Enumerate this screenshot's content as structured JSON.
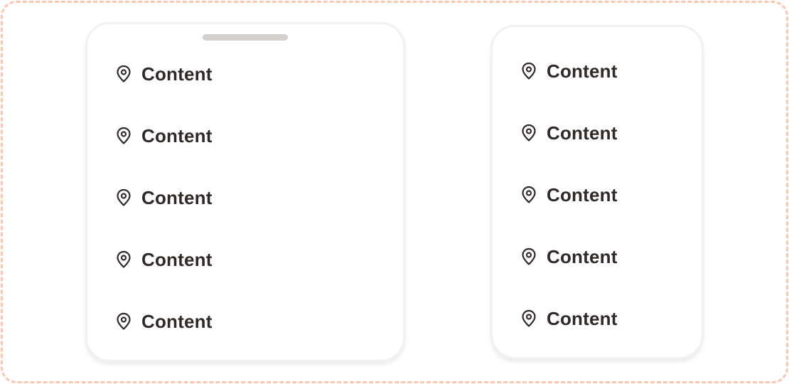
{
  "left_sheet": {
    "items": [
      {
        "label": "Content",
        "icon": "location-pin-icon"
      },
      {
        "label": "Content",
        "icon": "location-pin-icon"
      },
      {
        "label": "Content",
        "icon": "location-pin-icon"
      },
      {
        "label": "Content",
        "icon": "location-pin-icon"
      },
      {
        "label": "Content",
        "icon": "location-pin-icon"
      }
    ]
  },
  "right_sheet": {
    "items": [
      {
        "label": "Content",
        "icon": "location-pin-icon"
      },
      {
        "label": "Content",
        "icon": "location-pin-icon"
      },
      {
        "label": "Content",
        "icon": "location-pin-icon"
      },
      {
        "label": "Content",
        "icon": "location-pin-icon"
      },
      {
        "label": "Content",
        "icon": "location-pin-icon"
      }
    ]
  },
  "colors": {
    "frame_dash": "#fcc6b0",
    "text": "#2f2a28",
    "handle": "#d3cfce",
    "sheet_border": "#f1f1f1"
  }
}
